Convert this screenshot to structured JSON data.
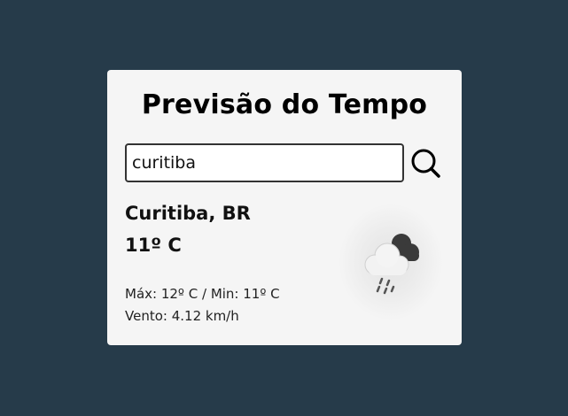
{
  "app": {
    "title": "Previsão do Tempo"
  },
  "search": {
    "value": "curitiba",
    "placeholder": "",
    "button_icon": "search-icon"
  },
  "weather": {
    "city": "Curitiba, BR",
    "temperature": "11º C",
    "minmax": "Máx: 12º C / Min: 11º C",
    "wind": "Vento: 4.12 km/h",
    "icon": "rain-cloud-icon"
  },
  "colors": {
    "background": "#263b4a",
    "card": "#f5f5f5",
    "text": "#111111"
  }
}
